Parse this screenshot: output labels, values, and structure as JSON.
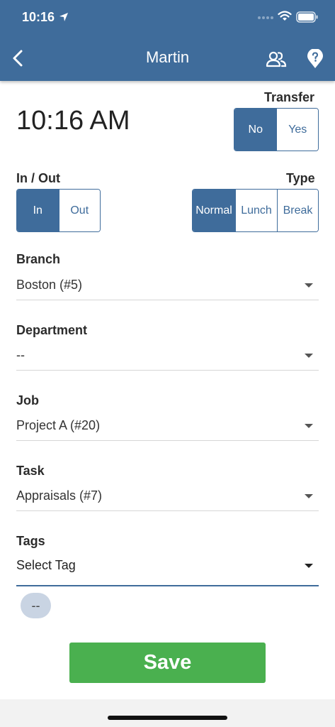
{
  "status_bar": {
    "time": "10:16"
  },
  "nav": {
    "title": "Martin"
  },
  "time_display": "10:16 AM",
  "transfer": {
    "label": "Transfer",
    "options": [
      "No",
      "Yes"
    ],
    "selected": "No"
  },
  "in_out": {
    "label": "In / Out",
    "options": [
      "In",
      "Out"
    ],
    "selected": "In"
  },
  "type": {
    "label": "Type",
    "options": [
      "Normal",
      "Lunch",
      "Break"
    ],
    "selected": "Normal"
  },
  "fields": {
    "branch": {
      "label": "Branch",
      "value": "Boston (#5)"
    },
    "department": {
      "label": "Department",
      "value": "--"
    },
    "job": {
      "label": "Job",
      "value": "Project A (#20)"
    },
    "task": {
      "label": "Task",
      "value": "Appraisals (#7)"
    },
    "tags": {
      "label": "Tags",
      "value": "Select Tag"
    }
  },
  "tag_chip": "--",
  "save_label": "Save",
  "colors": {
    "header": "#3f6c9b",
    "accent": "#3f6c9b",
    "save": "#4ab04f"
  },
  "icons": [
    "location-arrow-icon",
    "wifi-icon",
    "battery-icon",
    "back-chevron-icon",
    "users-icon",
    "help-marker-icon",
    "caret-down-icon"
  ]
}
